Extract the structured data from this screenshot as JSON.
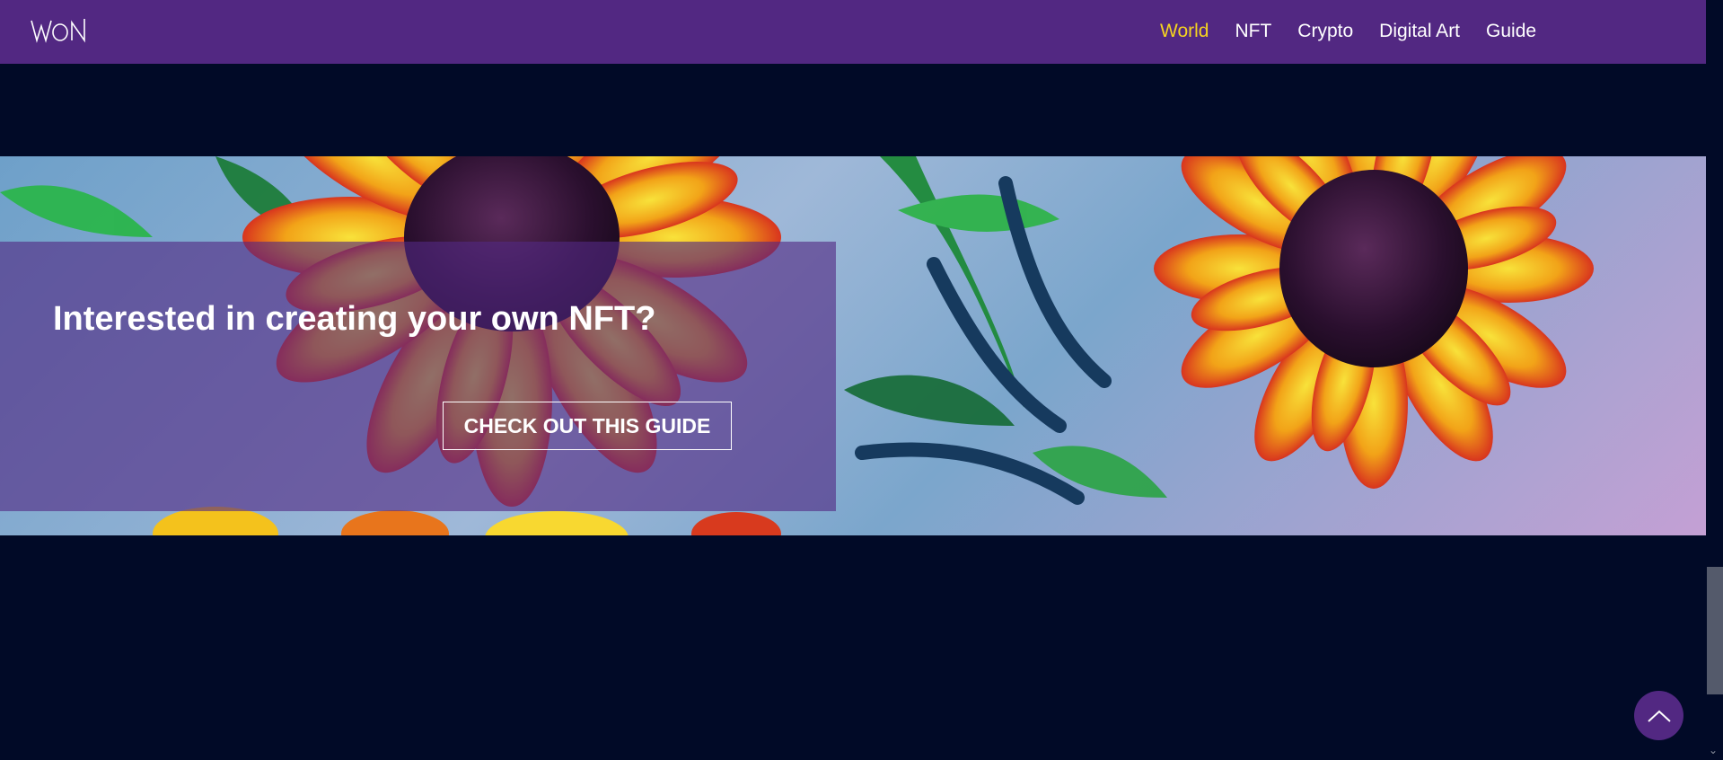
{
  "header": {
    "logo_text": "WON",
    "nav": [
      {
        "label": "World",
        "active": true
      },
      {
        "label": "NFT",
        "active": false
      },
      {
        "label": "Crypto",
        "active": false
      },
      {
        "label": "Digital Art",
        "active": false
      },
      {
        "label": "Guide",
        "active": false
      }
    ]
  },
  "banner": {
    "image": "sunflower-painting",
    "title": "Interested in creating your own NFT?",
    "cta_label": "CHECK OUT THIS GUIDE"
  },
  "back_to_top": {
    "icon": "chevron-up-icon"
  },
  "colors": {
    "header_bg": "#522882",
    "page_bg": "#010a27",
    "active_nav": "#f5d320",
    "overlay": "#522882"
  }
}
